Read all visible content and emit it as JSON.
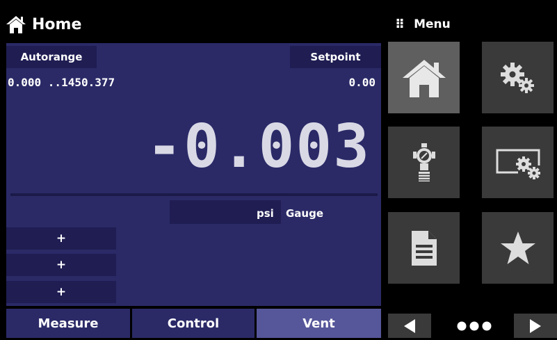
{
  "header": {
    "title": "Home",
    "menu_title": "Menu"
  },
  "readout": {
    "autorange_label": "Autorange",
    "setpoint_label": "Setpoint",
    "range_text": "0.000 ..1450.377",
    "setpoint_value": "0.00",
    "reading": "-0.003",
    "unit": "psi",
    "mode": "Gauge",
    "plus_buttons": [
      "+",
      "+",
      "+"
    ]
  },
  "tabs": [
    {
      "label": "Measure"
    },
    {
      "label": "Control"
    },
    {
      "label": "Vent",
      "active": true
    }
  ],
  "menu_tiles": [
    "home-icon",
    "settings-icon",
    "regulator-icon",
    "display-settings-icon",
    "document-icon",
    "star-icon"
  ],
  "pager": {
    "current": 1,
    "count": 3
  },
  "colors": {
    "panel": "#2b2a67",
    "chip": "#1f1d52",
    "vent_active": "#56579a",
    "tile": "#3a3a3a",
    "tile_active": "#5f5f5f"
  }
}
